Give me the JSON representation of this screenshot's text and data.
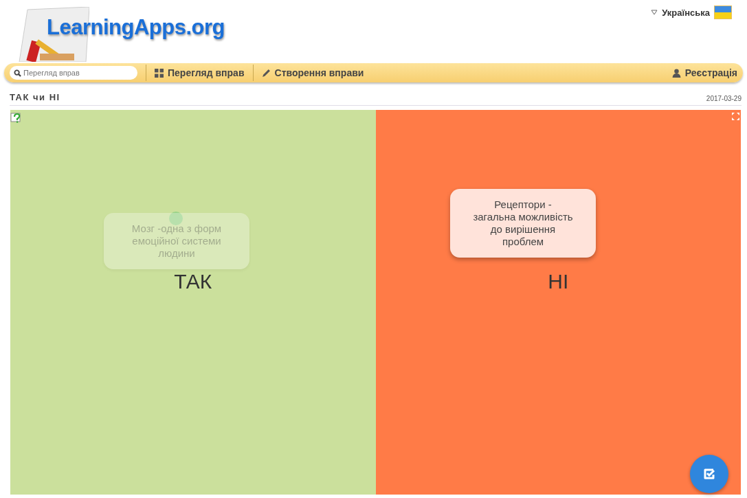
{
  "header": {
    "logo": "LearningApps.org",
    "language": "Українська"
  },
  "nav": {
    "search": {
      "placeholder": "Перегляд вправ"
    },
    "items": [
      {
        "label": "Перегляд вправ",
        "kind": "grid"
      },
      {
        "label": "Створення вправи",
        "kind": "pencil"
      }
    ],
    "register": "Реєстрація"
  },
  "exercise": {
    "title": "ТАК чи НІ",
    "date": "2017-03-29"
  },
  "board": {
    "zones": [
      {
        "label": "ТАК",
        "color": "#cbe09c"
      },
      {
        "label": "НІ",
        "color": "#ff7b47"
      }
    ],
    "cards": [
      {
        "text": "Мозг -одна з форм емоційної системи людини",
        "faded": true
      },
      {
        "text": "Рецептори - загальна можливість до вирішення проблем",
        "faded": false
      }
    ]
  }
}
